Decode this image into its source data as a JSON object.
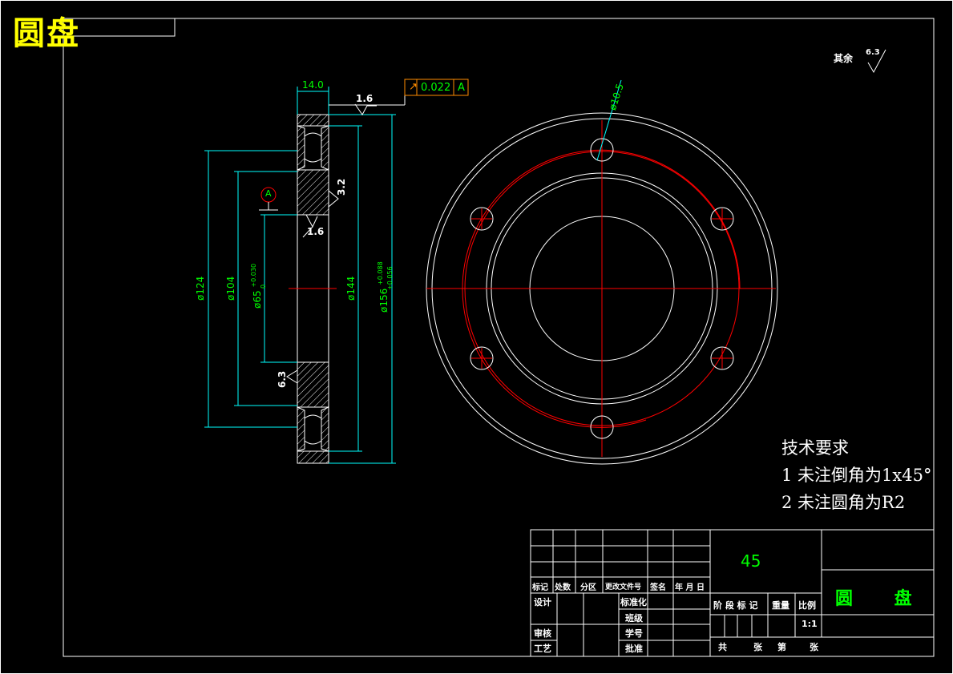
{
  "title": "圆盘",
  "surface_roughness_other": {
    "label": "其余",
    "value": "6.3"
  },
  "section_view": {
    "width_dim": "14.0",
    "top_roughness": "1.6",
    "geometric_tolerance": {
      "symbol": "↗",
      "value": "0.022",
      "datum": "A"
    },
    "datum_label": "A",
    "inner_roughness": "3.2",
    "bottom_roughness": "1.6",
    "lower_roughness": "6.3",
    "dims": {
      "d124": "ø124",
      "d104": "ø104",
      "d65": "ø65",
      "d65_tol_upper": "+0.030",
      "d65_tol_lower": "0",
      "d144": "ø144",
      "d156": "ø156",
      "d156_tol_upper": "+0.088",
      "d156_tol_lower": "+0.056"
    }
  },
  "front_view": {
    "hole_dim": "ø10.5"
  },
  "technical_requirements": {
    "heading": "技术要求",
    "items": [
      "1 未注倒角为1x45°",
      "2 未注圆角为R2"
    ]
  },
  "title_block": {
    "material": "45",
    "part_name": "圆 盘",
    "ratio": "1:1",
    "headers": [
      "标记",
      "处数",
      "分区",
      "更改文件号",
      "签名",
      "年 月 日"
    ],
    "design": "设计",
    "standardization": "标准化",
    "class": "班级",
    "review": "审核",
    "student_id": "学号",
    "process": "工艺",
    "approve": "批准",
    "stage_mark": "阶 段 标 记",
    "weight": "重量",
    "scale": "比例",
    "total_sheets": "共",
    "sheets_unit1": "张",
    "sheet_no": "第",
    "sheets_unit2": "张"
  },
  "colors": {
    "outline": "#ffffff",
    "dimension": "#00ffff",
    "dim_text": "#00ff00",
    "centerline": "#ff0000",
    "title": "#ffff00"
  }
}
